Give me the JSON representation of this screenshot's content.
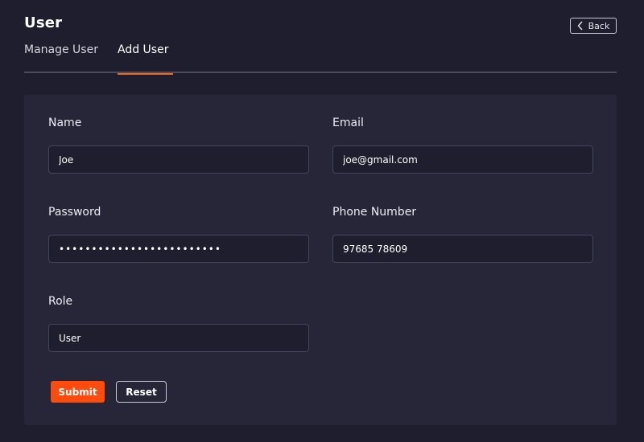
{
  "header": {
    "title": "User",
    "back_label": "Back"
  },
  "tabs": [
    {
      "label": "Manage User",
      "active": false
    },
    {
      "label": "Add User",
      "active": true
    }
  ],
  "form": {
    "name": {
      "label": "Name",
      "value": "Joe"
    },
    "email": {
      "label": "Email",
      "value": "joe@gmail.com"
    },
    "password": {
      "label": "Password",
      "value": "•••••••••••••••••••••••••"
    },
    "phone": {
      "label": "Phone Number",
      "value": "97685 78609"
    },
    "role": {
      "label": "Role",
      "value": "User"
    },
    "submit_label": "Submit",
    "reset_label": "Reset"
  },
  "colors": {
    "background": "#1e1e2e",
    "panel": "#262638",
    "accent": "#ff4b0d",
    "tab_underline": "#f26a1b"
  },
  "icons": {
    "back": "chevron-left-icon"
  }
}
